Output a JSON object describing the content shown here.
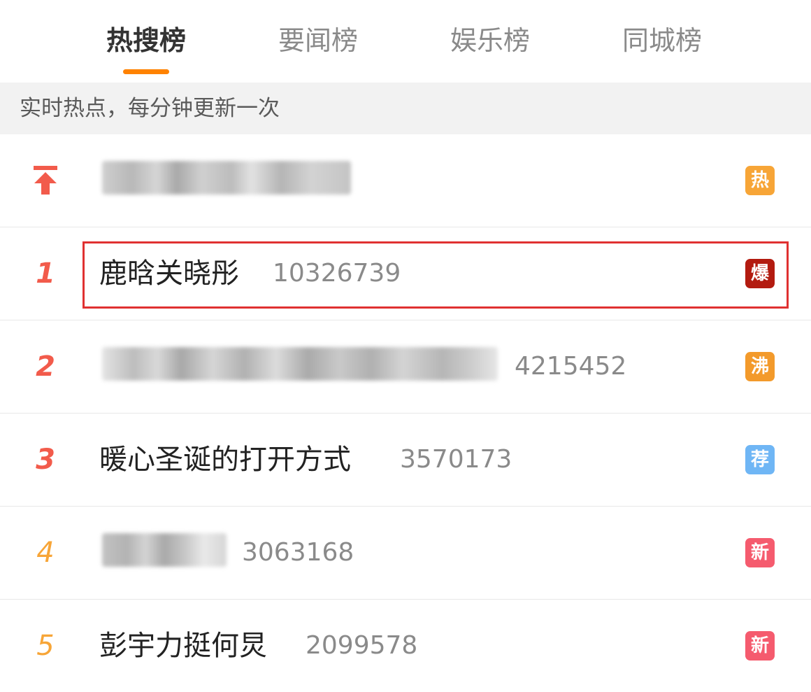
{
  "tabs": [
    {
      "label": "热搜榜",
      "active": true
    },
    {
      "label": "要闻榜",
      "active": false
    },
    {
      "label": "娱乐榜",
      "active": false
    },
    {
      "label": "同城榜",
      "active": false
    }
  ],
  "subheader": "实时热点，每分钟更新一次",
  "colors": {
    "accent_underline": "#ff8200",
    "rank_top": "#f25b4b",
    "rank_other": "#f7a537",
    "highlight_border": "#e03131",
    "badge_hot": "#f7a537",
    "badge_explode": "#b31b10",
    "badge_boil": "#f39a2b",
    "badge_recommend": "#6fb6f5",
    "badge_new": "#f55b6e"
  },
  "pinned": {
    "icon": "pin-top-arrow-icon",
    "title_blurred": true,
    "badge": "热"
  },
  "items": [
    {
      "rank": "1",
      "title": "鹿晗关晓彤",
      "count": "10326739",
      "badge": "爆",
      "highlighted": true
    },
    {
      "rank": "2",
      "title_blurred": true,
      "count": "4215452",
      "badge": "沸"
    },
    {
      "rank": "3",
      "title": "暖心圣诞的打开方式",
      "count": "3570173",
      "badge": "荐"
    },
    {
      "rank": "4",
      "title_blurred": true,
      "count": "3063168",
      "badge": "新"
    },
    {
      "rank": "5",
      "title": "彭宇力挺何炅",
      "count": "2099578",
      "badge": "新"
    }
  ]
}
